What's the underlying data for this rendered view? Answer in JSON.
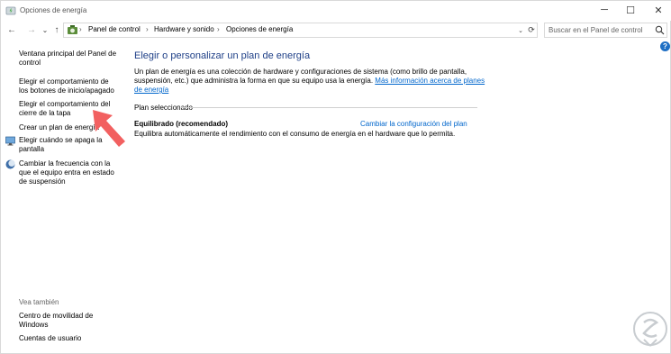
{
  "window": {
    "title": "Opciones de energía",
    "minimize_glyph": "─",
    "maximize_glyph": "☐",
    "close_glyph": "✕"
  },
  "nav": {
    "back_glyph": "←",
    "forward_glyph": "→",
    "down_glyph": "⌄",
    "up_glyph": "↑",
    "refresh_glyph": "⟳",
    "breadcrumbs": [
      "Panel de control",
      "Hardware y sonido",
      "Opciones de energía"
    ],
    "separator": "›"
  },
  "search": {
    "placeholder": "Buscar en el Panel de control"
  },
  "help_glyph": "?",
  "sidebar": {
    "items": [
      {
        "label": "Ventana principal del Panel de control"
      },
      {
        "label": "Elegir el comportamiento de los botones de inicio/apagado"
      },
      {
        "label": "Elegir el comportamiento del cierre de la tapa"
      },
      {
        "label": "Crear un plan de energía"
      },
      {
        "label": "Elegir cuándo se apaga la pantalla",
        "icon": "monitor-icon"
      },
      {
        "label": "Cambiar la frecuencia con la que el equipo entra en estado de suspensión",
        "icon": "moon-icon"
      }
    ],
    "see_also": "Vea también",
    "see_also_items": [
      {
        "label": "Centro de movilidad de Windows"
      },
      {
        "label": "Cuentas de usuario"
      }
    ]
  },
  "main": {
    "heading": "Elegir o personalizar un plan de energía",
    "intro_text": "Un plan de energía es una colección de hardware y configuraciones de sistema (como brillo de pantalla, suspensión, etc.) que administra la forma en que su equipo usa la energía. ",
    "intro_link": "Más información acerca de planes de energía",
    "plan_section": "Plan seleccionado",
    "plan_name": "Equilibrado (recomendado)",
    "plan_change_link": "Cambiar la configuración del plan",
    "plan_description": "Equilibra automáticamente el rendimiento con el consumo de energía en el hardware que lo permita."
  },
  "colors": {
    "heading": "#1e3f87",
    "link": "#0066cc",
    "arrow": "#f26060",
    "help": "#1f6fc4"
  }
}
